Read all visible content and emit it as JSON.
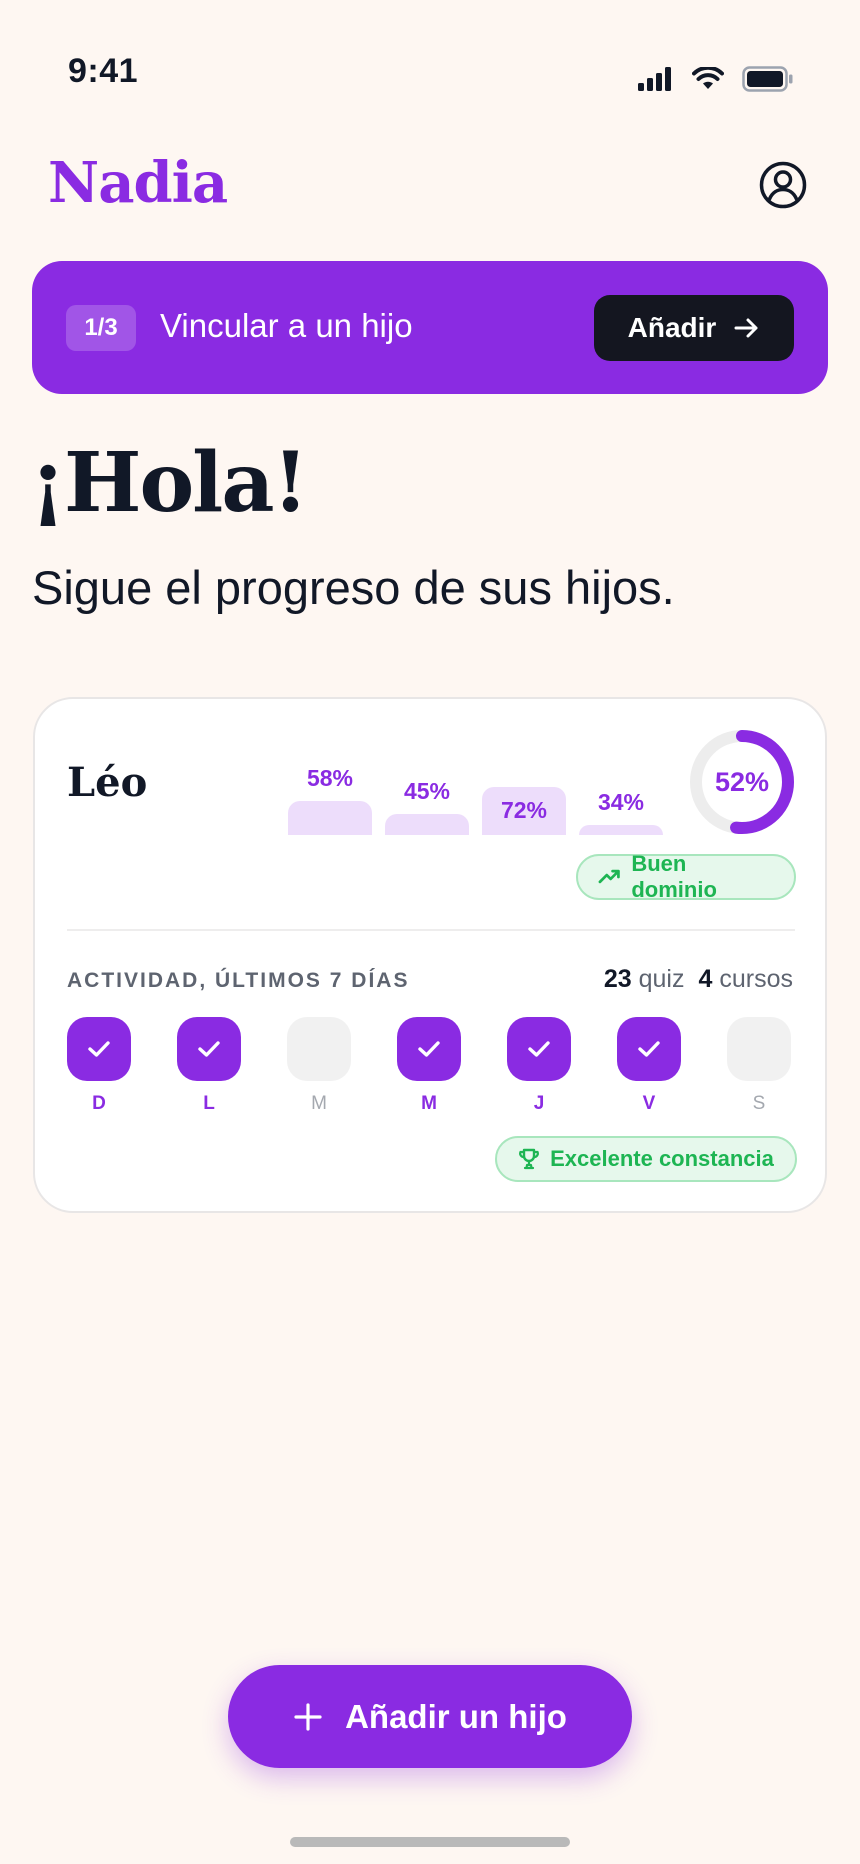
{
  "status_bar": {
    "time": "9:41"
  },
  "header": {
    "logo": "Nadia"
  },
  "banner": {
    "step": "1/3",
    "text": "Vincular a un hijo",
    "button_label": "Añadir"
  },
  "greeting": "¡Hola!",
  "subtitle": "Sigue el progreso de sus hijos.",
  "child": {
    "name": "Léo",
    "scores": [
      {
        "label": "58%",
        "value": 58
      },
      {
        "label": "45%",
        "value": 45
      },
      {
        "label": "72%",
        "value": 72
      },
      {
        "label": "34%",
        "value": 34
      }
    ],
    "overall": {
      "label": "52%",
      "value": 52
    },
    "mastery_badge": "Buen dominio",
    "activity_label": "ACTIVIDAD, ÚLTIMOS 7 DÍAS",
    "stats": {
      "quiz_count": "23",
      "quiz_label": "quiz",
      "course_count": "4",
      "course_label": "cursos"
    },
    "days": [
      {
        "letter": "D",
        "done": true
      },
      {
        "letter": "L",
        "done": true
      },
      {
        "letter": "M",
        "done": false
      },
      {
        "letter": "M",
        "done": true
      },
      {
        "letter": "J",
        "done": true
      },
      {
        "letter": "V",
        "done": true
      },
      {
        "letter": "S",
        "done": false
      }
    ],
    "streak_badge": "Excelente constancia"
  },
  "fab": {
    "label": "Añadir un hijo"
  },
  "colors": {
    "accent": "#8A2BE2",
    "success": "#1EB553",
    "background": "#FEF7F2"
  }
}
